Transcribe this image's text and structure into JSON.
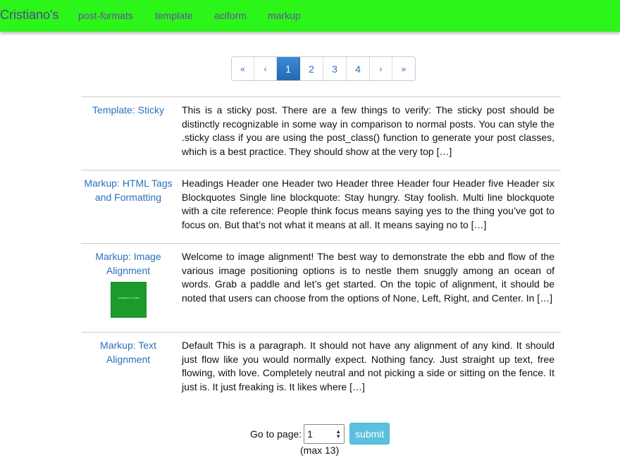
{
  "header": {
    "brand": "Cristiano's",
    "nav": [
      "post-formats",
      "template",
      "aciform",
      "markup"
    ],
    "bar_color": "#2bf519"
  },
  "pagination": {
    "first": "«",
    "prev": "‹",
    "pages": [
      "1",
      "2",
      "3",
      "4"
    ],
    "current": "1",
    "next": "›",
    "last": "»"
  },
  "posts": [
    {
      "title": "Template: Sticky",
      "excerpt": "This is a sticky post. There are a few things to verify: The sticky post should be distinctly recognizable in some way in comparison to normal posts. You can style the .sticky class if you are using the post_class() function to generate your post classes, which is a best practice. They should show at the very top […]"
    },
    {
      "title": "Markup: HTML Tags and Formatting",
      "excerpt": "Headings Header one Header two Header three Header four Header five Header six Blockquotes Single line blockquote: Stay hungry. Stay foolish. Multi line blockquote with a cite reference: People think focus means saying yes to the thing you’ve got to focus on. But that’s not what it means at all. It means saying no to […]"
    },
    {
      "title": "Markup: Image Alignment",
      "excerpt": "Welcome to image alignment! The best way to demonstrate the ebb and flow of the various image positioning options is to nestle them snuggly among an ocean of words. Grab a paddle and let’s get started. On the topic of alignment, it should be noted that users can choose from the options of None, Left, Right, and Center. In […]",
      "thumbnail_caption": "I AM BEAUTY LOVING"
    },
    {
      "title": "Markup: Text Alignment",
      "excerpt": "Default This is a paragraph. It should not have any alignment of any kind. It should just flow like you would normally expect. Nothing fancy. Just straight up text, free flowing, with love. Completely neutral and not picking a side or sitting on the fence. It just is. It just freaking is. It likes where […]"
    }
  ],
  "goto": {
    "label": "Go to page:",
    "value": "1",
    "submit": "submit",
    "max_note": "(max 13)"
  }
}
